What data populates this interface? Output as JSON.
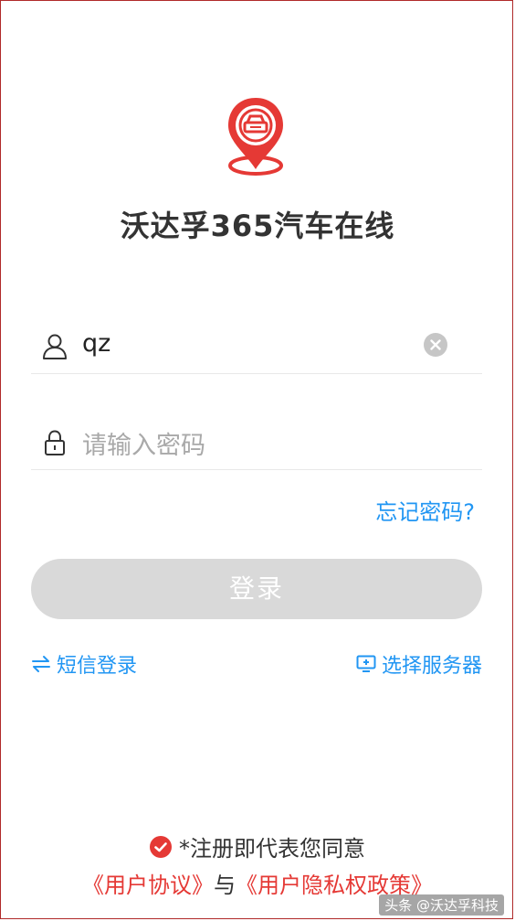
{
  "app": {
    "title": "沃达孚365汽车在线"
  },
  "login": {
    "username_value": "qz",
    "password_placeholder": "请输入密码",
    "forgot_label": "忘记密码?",
    "login_label": "登录",
    "sms_login_label": "短信登录",
    "select_server_label": "选择服务器"
  },
  "agreement": {
    "text": "*注册即代表您同意",
    "user_agreement": "《用户协议》",
    "and": "与",
    "privacy_policy": "《用户隐私权政策》"
  },
  "watermark": "头条 @沃达孚科技",
  "colors": {
    "brand_red": "#e53935",
    "link_blue": "#2196f3",
    "disabled_button": "#d9d9d9"
  },
  "icons": [
    "car-location-pin-icon",
    "user-icon",
    "lock-icon",
    "clear-icon",
    "swap-arrows-icon",
    "monitor-icon",
    "check-circle-icon"
  ]
}
